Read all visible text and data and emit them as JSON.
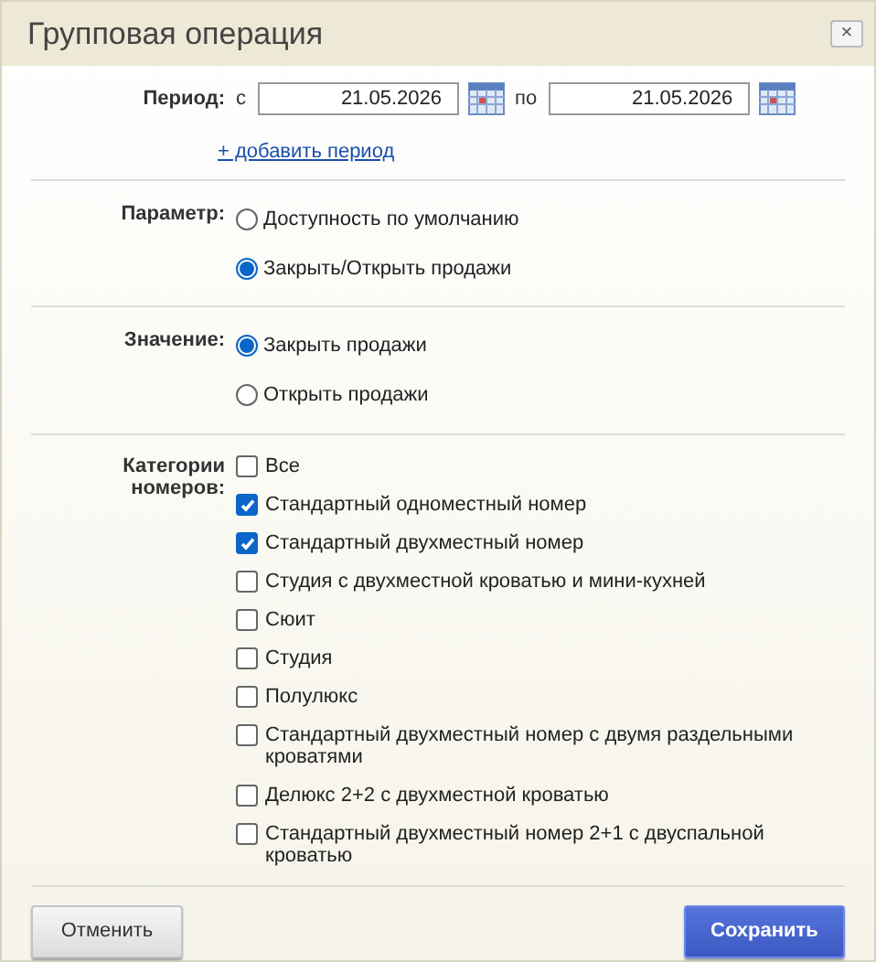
{
  "window": {
    "title": "Групповая операция",
    "close": "×"
  },
  "period": {
    "label": "Период:",
    "from_label": "с",
    "from": "21.05.2026",
    "to_label": "по",
    "to": "21.05.2026",
    "add_link": "+ добавить период"
  },
  "parameter": {
    "label": "Параметр:",
    "options": [
      {
        "label": "Доступность по умолчанию",
        "selected": false
      },
      {
        "label": "Закрыть/Открыть продажи",
        "selected": true
      }
    ]
  },
  "value": {
    "label": "Значение:",
    "options": [
      {
        "label": "Закрыть продажи",
        "selected": true
      },
      {
        "label": "Открыть продажи",
        "selected": false
      }
    ]
  },
  "categories": {
    "label": "Категории номеров:",
    "items": [
      {
        "label": "Все",
        "checked": false
      },
      {
        "label": "Стандартный одноместный номер",
        "checked": true
      },
      {
        "label": "Стандартный двухместный номер",
        "checked": true
      },
      {
        "label": "Студия с двухместной кроватью и мини-кухней",
        "checked": false
      },
      {
        "label": "Сюит",
        "checked": false
      },
      {
        "label": "Студия",
        "checked": false
      },
      {
        "label": "Полулюкс",
        "checked": false
      },
      {
        "label": "Стандартный двухместный номер с двумя раздельными кроватями",
        "checked": false
      },
      {
        "label": "Делюкс 2+2 с двухместной кроватью",
        "checked": false
      },
      {
        "label": "Стандартный двухместный номер 2+1 с двуспальной кроватью",
        "checked": false
      }
    ]
  },
  "buttons": {
    "cancel": "Отменить",
    "save": "Сохранить"
  }
}
